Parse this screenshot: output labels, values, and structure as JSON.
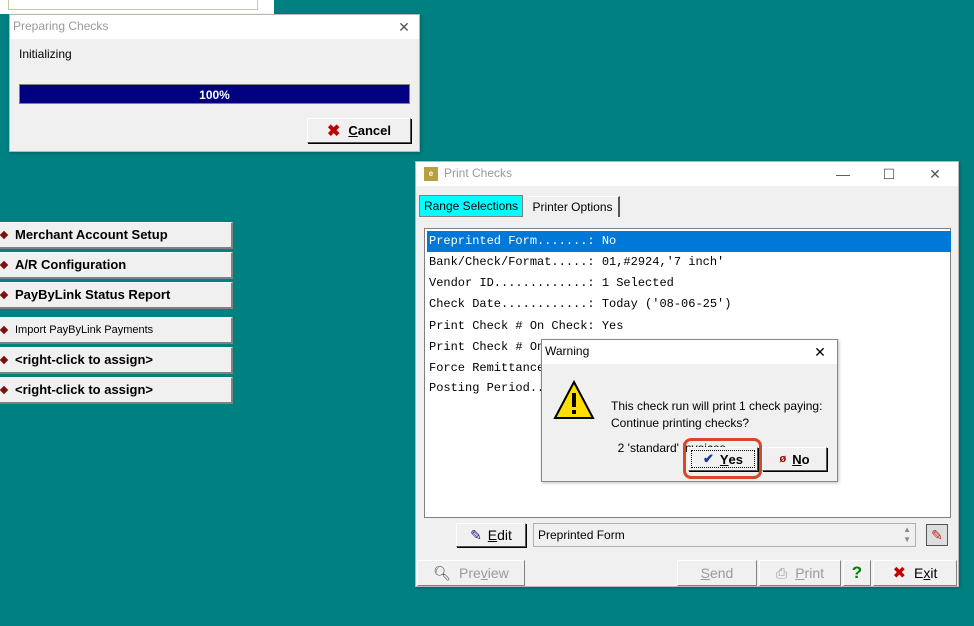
{
  "preparing": {
    "title": "Preparing Checks",
    "status": "Initializing",
    "progress_pct": 100,
    "progress_label": "100%",
    "cancel": {
      "pre": "",
      "ul": "C",
      "post": "ancel"
    }
  },
  "left_menu": {
    "items": [
      {
        "label": "Merchant Account Setup",
        "small": false
      },
      {
        "label": "A/R Configuration",
        "small": false
      },
      {
        "label": "PayByLink Status Report",
        "small": false
      },
      {
        "label": "Import PayByLink Payments",
        "small": true
      },
      {
        "label": "<right-click to assign>",
        "small": false
      },
      {
        "label": "<right-click to assign>",
        "small": false
      }
    ]
  },
  "print_checks": {
    "title": "Print Checks",
    "tabs": [
      "Range Selections",
      "Printer Options"
    ],
    "rows": [
      "Preprinted Form.......: No",
      "Bank/Check/Format.....: 01,#2924,'7 inch'",
      "Vendor ID.............: 1 Selected",
      "Check Date............: Today ('08-06-25')",
      "Print Check # On Check: Yes",
      "Print Check # On",
      "Force Remittance",
      "Posting Period.."
    ],
    "edit": {
      "pre": "",
      "ul": "E",
      "post": "dit"
    },
    "field_value": "Preprinted Form",
    "buttons": {
      "preview": {
        "pre": "Pre",
        "ul": "v",
        "post": "iew"
      },
      "send": {
        "pre": "",
        "ul": "S",
        "post": "end"
      },
      "print": {
        "pre": "",
        "ul": "P",
        "post": "rint"
      },
      "help": "?",
      "exit": {
        "pre": "E",
        "ul": "x",
        "post": "it"
      }
    }
  },
  "warning": {
    "title": "Warning",
    "message_line1": "This check run will print 1 check paying:",
    "message_line2": "  2 'standard' invoices.",
    "question": "Continue printing checks?",
    "yes": {
      "pre": "",
      "ul": "Y",
      "post": "es"
    },
    "no": {
      "pre": "",
      "ul": "N",
      "post": "o"
    }
  },
  "colors": {
    "desktop": "#008080",
    "progress": "#000080",
    "selection": "#0078d7",
    "active_tab": "#00ffff",
    "highlight_ring": "#d9472b"
  }
}
